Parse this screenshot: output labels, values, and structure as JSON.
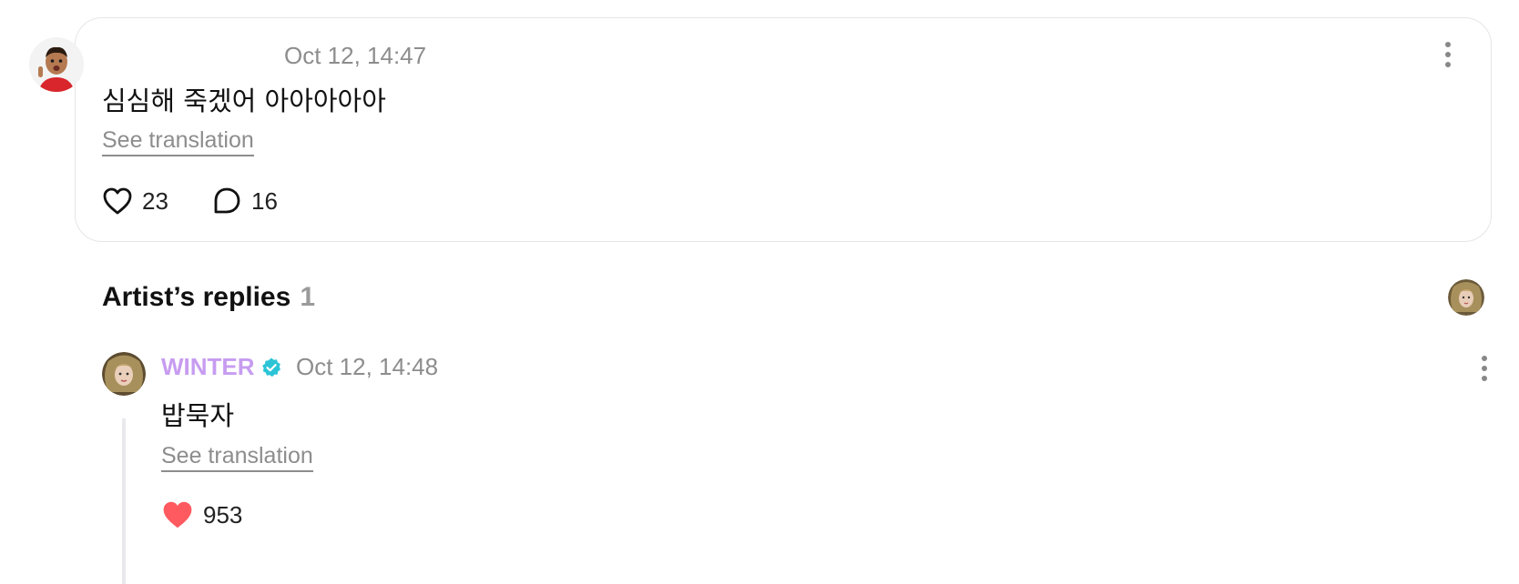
{
  "comment": {
    "time": "Oct 12, 14:47",
    "text": "심심해 죽겠어 아아아아아",
    "see_translation": "See translation",
    "likes": "23",
    "replies": "16"
  },
  "artist_replies": {
    "title": "Artist’s replies",
    "count": "1"
  },
  "reply": {
    "author": "WINTER",
    "time": "Oct 12, 14:48",
    "text": "밥묵자",
    "see_translation": "See translation",
    "likes": "953"
  },
  "colors": {
    "artist_name": "#c79cf0",
    "verified_badge": "#2bc4d6",
    "liked_heart": "#ff5a5f",
    "muted_text": "#8d8d8d"
  },
  "icons": {
    "like": "heart-outline-icon",
    "reply": "speech-bubble-icon",
    "liked": "heart-filled-icon",
    "verified": "verified-badge-icon",
    "more": "kebab-menu-icon"
  }
}
